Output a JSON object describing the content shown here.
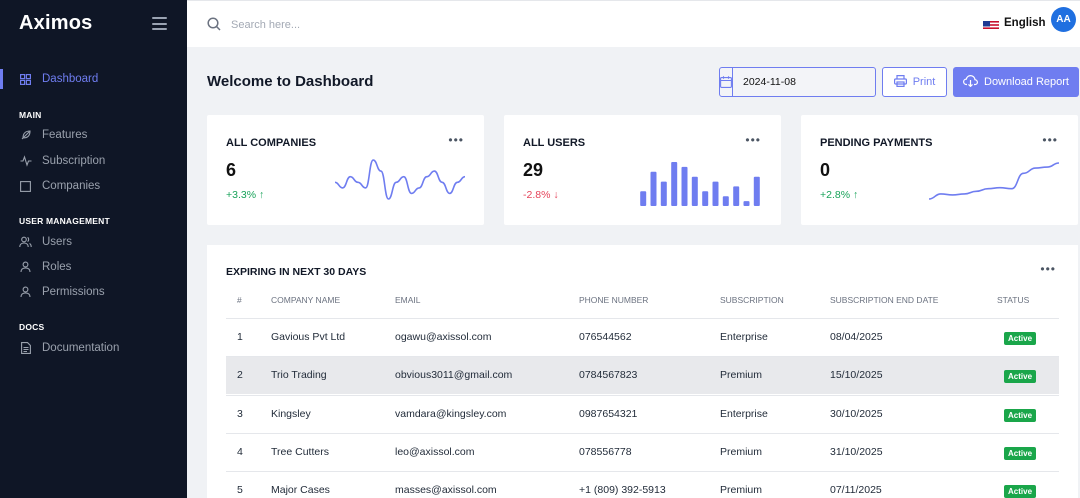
{
  "app": {
    "brand": "Aximos"
  },
  "sidebar": {
    "dashboard": "Dashboard",
    "sections": [
      {
        "heading": "MAIN",
        "items": [
          "Features",
          "Subscription",
          "Companies"
        ]
      },
      {
        "heading": "USER MANAGEMENT",
        "items": [
          "Users",
          "Roles",
          "Permissions"
        ]
      },
      {
        "heading": "DOCS",
        "items": [
          "Documentation"
        ]
      }
    ]
  },
  "topbar": {
    "search_placeholder": "Search here...",
    "language": "English",
    "avatar": "AA"
  },
  "header": {
    "title": "Welcome to Dashboard",
    "date": "2024-11-08",
    "print_label": "Print",
    "download_label": "Download Report"
  },
  "cards": [
    {
      "title": "ALL COMPANIES",
      "value": "6",
      "change": "+3.3%",
      "trend": "up",
      "chart": "line",
      "series": [
        5,
        4,
        6,
        5,
        4,
        9,
        7,
        2,
        5,
        6,
        3,
        4,
        6,
        7,
        5,
        3,
        5,
        6
      ]
    },
    {
      "title": "ALL USERS",
      "value": "29",
      "change": "-2.8%",
      "trend": "down",
      "chart": "bar",
      "series": [
        3,
        7,
        5,
        9,
        8,
        6,
        3,
        5,
        2,
        4,
        1,
        6
      ]
    },
    {
      "title": "PENDING PAYMENTS",
      "value": "0",
      "change": "+2.8%",
      "trend": "up",
      "chart": "line",
      "series": [
        1,
        2,
        1.8,
        2,
        2.5,
        3,
        3.2,
        3,
        6,
        7,
        7.2,
        8
      ]
    }
  ],
  "expiring": {
    "title": "EXPIRING IN NEXT 30 DAYS",
    "columns": [
      "#",
      "COMPANY NAME",
      "EMAIL",
      "PHONE NUMBER",
      "SUBSCRIPTION",
      "SUBSCRIPTION END DATE",
      "STATUS"
    ],
    "rows": [
      [
        "1",
        "Gavious Pvt Ltd",
        "ogawu@axissol.com",
        "076544562",
        "Enterprise",
        "08/04/2025",
        "Active"
      ],
      [
        "2",
        "Trio Trading",
        "obvious3011@gmail.com",
        "0784567823",
        "Premium",
        "15/10/2025",
        "Active"
      ],
      [
        "3",
        "Kingsley",
        "vamdara@kingsley.com",
        "0987654321",
        "Enterprise",
        "30/10/2025",
        "Active"
      ],
      [
        "4",
        "Tree Cutters",
        "leo@axissol.com",
        "078556778",
        "Premium",
        "31/10/2025",
        "Active"
      ],
      [
        "5",
        "Major Cases",
        "masses@axissol.com",
        "+1 (809) 392-5913",
        "Premium",
        "07/11/2025",
        "Active"
      ]
    ]
  },
  "colors": {
    "accent": "#6f7df0",
    "sidebar_bg": "#0f1626",
    "up": "#19a35a",
    "down": "#e5445a",
    "badge": "#1aa64a"
  }
}
